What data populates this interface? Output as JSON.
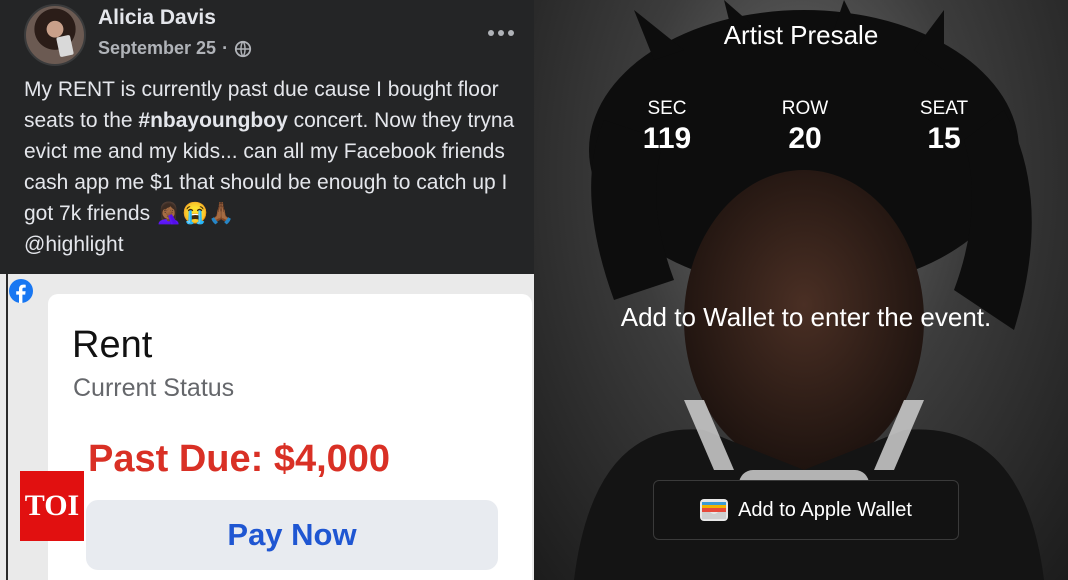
{
  "post": {
    "author": "Alicia Davis",
    "date": "September 25",
    "separator": "·",
    "icons": {
      "audience": "globe-icon",
      "menu": "more-options-icon"
    },
    "text_before_hashtag": "My RENT is currently past due cause I bought floor seats to the ",
    "hashtag": "#nbayoungboy",
    "text_after_hashtag": " concert. Now they tryna evict me and my kids... can all my Facebook friends cash app me $1 that should be enough to catch up I got 7k friends 🤦🏾‍♀️😭🙏🏾\n@highlight"
  },
  "rent_card": {
    "icon": "facebook-icon",
    "title": "Rent",
    "status_label": "Current Status",
    "past_due": "Past Due: $4,000",
    "pay_button": "Pay Now"
  },
  "watermark": {
    "logo_text": "TOI"
  },
  "ticket": {
    "title": "Artist Presale",
    "seats": [
      {
        "label": "SEC",
        "value": "119"
      },
      {
        "label": "ROW",
        "value": "20"
      },
      {
        "label": "SEAT",
        "value": "15"
      }
    ],
    "message": "Add to Wallet to enter the event.",
    "wallet_button": "Add to Apple Wallet",
    "wallet_icon": "apple-wallet-icon"
  },
  "colors": {
    "facebook_dark": "#242526",
    "facebook_blue": "#1877f2",
    "past_due_red": "#d93025",
    "pay_button_text": "#1f56d2",
    "toi_red": "#e11010"
  }
}
